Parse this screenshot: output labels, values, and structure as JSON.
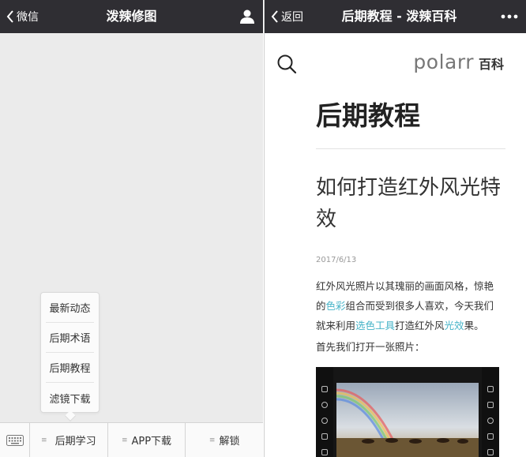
{
  "left_screen": {
    "nav": {
      "back_label": "微信",
      "title": "泼辣修图",
      "profile_icon": "person-icon"
    },
    "submenu": [
      "最新动态",
      "后期术语",
      "后期教程",
      "滤镜下载"
    ],
    "bottom_menu": {
      "keyboard_icon": "keyboard-icon",
      "items": [
        {
          "label": "后期学习",
          "has_submenu": true
        },
        {
          "label": "APP下载",
          "has_submenu": true
        },
        {
          "label": "解锁",
          "has_submenu": true
        }
      ]
    }
  },
  "right_screen": {
    "nav": {
      "back_label": "返回",
      "title": "后期教程 - 泼辣百科",
      "more_icon": "more-dots-icon"
    },
    "brand": {
      "logo": "polarr",
      "suffix": "百科"
    },
    "section_title": "后期教程",
    "article": {
      "title": "如何打造红外风光特效",
      "date": "2017/6/13",
      "p1": {
        "t1": "红外风光照片以其瑰丽的画面风格，惊艳的",
        "link1": "色彩",
        "t2": "组合而受到很多人喜欢，今天我们就来利用",
        "link2": "选色工具",
        "t3": "打造红外风",
        "link3": "光效",
        "t4": "果。"
      },
      "p2": "首先我们打开一张照片："
    }
  },
  "colors": {
    "navbar": "#2f2e33",
    "link": "#47b4c8",
    "background_left": "#ebebeb"
  }
}
